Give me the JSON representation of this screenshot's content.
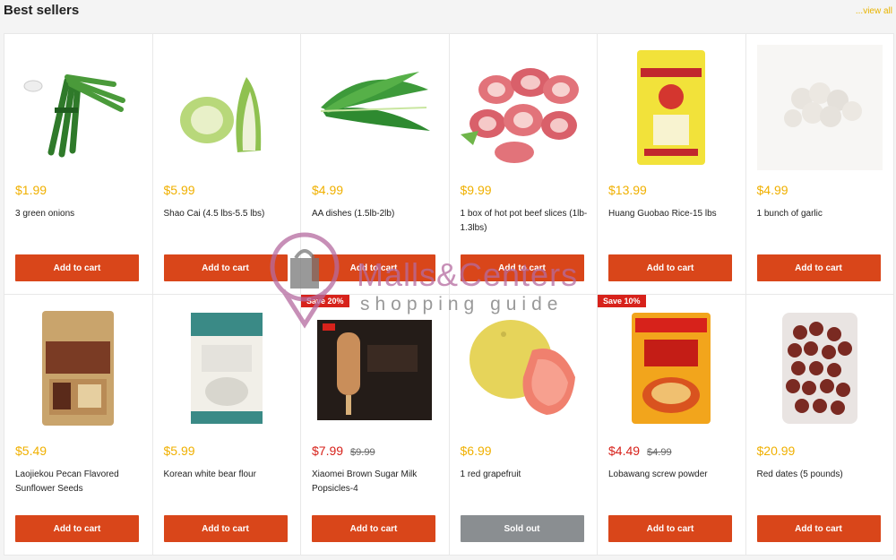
{
  "header": {
    "title": "Best sellers",
    "view_all": "...view all"
  },
  "products": [
    {
      "price": "$1.99",
      "name": "3 green onions",
      "button": "Add to cart",
      "image": "green-onion"
    },
    {
      "price": "$5.99",
      "name": "Shao Cai (4.5 lbs-5.5 lbs)",
      "button": "Add to cart",
      "image": "napa-cabbage"
    },
    {
      "price": "$4.99",
      "name": "AA dishes (1.5lb-2lb)",
      "button": "Add to cart",
      "image": "leafy-greens"
    },
    {
      "price": "$9.99",
      "name": "1 box of hot pot beef slices (1lb-1.3lbs)",
      "button": "Add to cart",
      "image": "beef-slices"
    },
    {
      "price": "$13.99",
      "name": "Huang Guobao Rice-15 lbs",
      "button": "Add to cart",
      "image": "rice-bag"
    },
    {
      "price": "$4.99",
      "name": "1 bunch of garlic",
      "button": "Add to cart",
      "image": "garlic"
    },
    {
      "price": "$5.49",
      "name": "Laojiekou Pecan Flavored Sunflower Seeds",
      "button": "Add to cart",
      "image": "seeds-bag"
    },
    {
      "price": "$5.99",
      "name": "Korean white bear flour",
      "button": "Add to cart",
      "image": "flour-bag"
    },
    {
      "badge": "Save 20%",
      "price": "$7.99",
      "old_price": "$9.99",
      "name": "Xiaomei Brown Sugar Milk Popsicles-4",
      "button": "Add to cart",
      "image": "popsicle-box"
    },
    {
      "price": "$6.99",
      "name": "1 red grapefruit",
      "button": "Sold out",
      "image": "grapefruit"
    },
    {
      "badge": "Save 10%",
      "price": "$4.49",
      "old_price": "$4.99",
      "name": "Lobawang screw powder",
      "button": "Add to cart",
      "image": "noodle-bag"
    },
    {
      "price": "$20.99",
      "name": "Red dates (5 pounds)",
      "button": "Add to cart",
      "image": "red-dates"
    }
  ],
  "watermark": {
    "line1": "Malls&Centers",
    "line2": "shopping guide"
  },
  "colors": {
    "accent": "#d9461a",
    "price": "#f0b000",
    "sale": "#d7221b",
    "soldout": "#8a8e91"
  }
}
